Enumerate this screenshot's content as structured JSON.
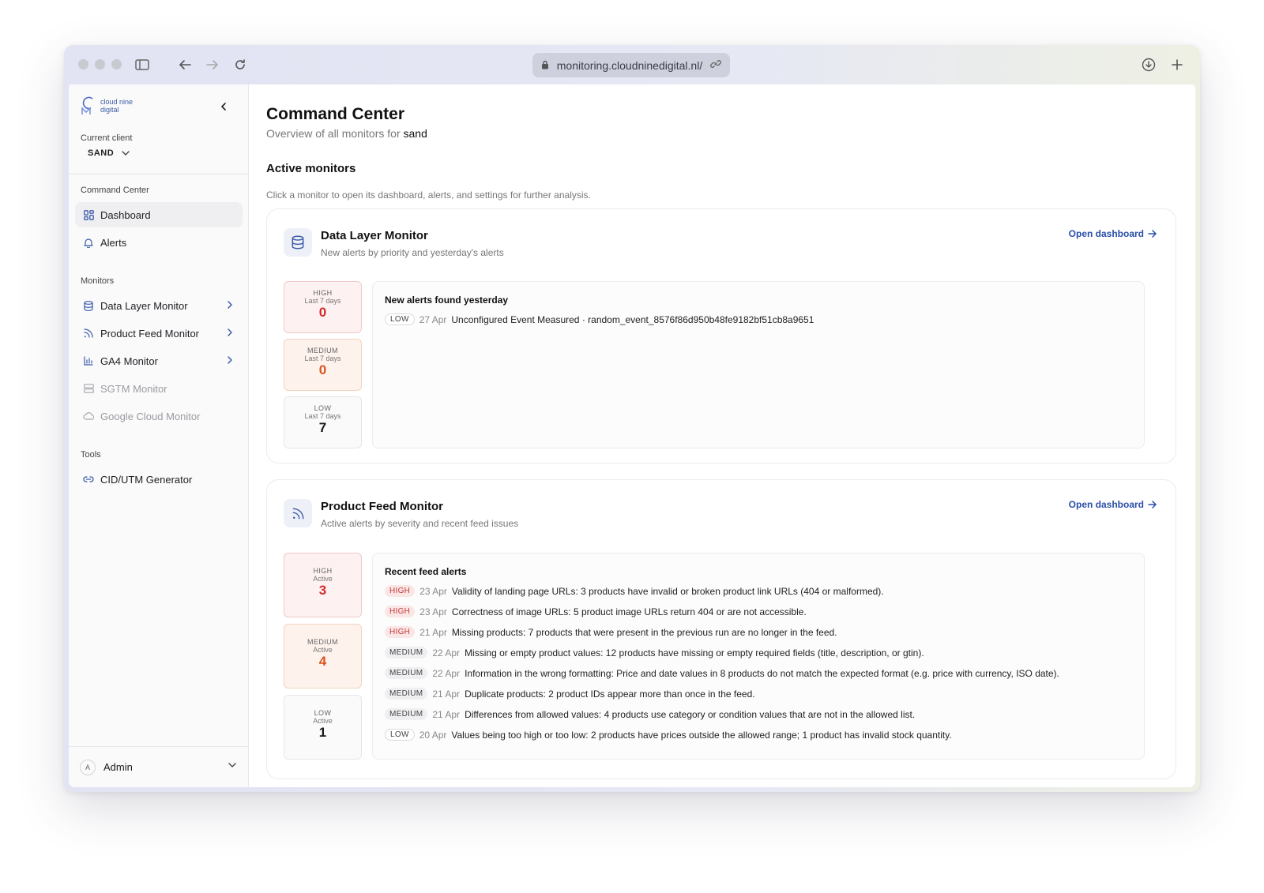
{
  "browser": {
    "url": "monitoring.cloudninedigital.nl/"
  },
  "sidebar": {
    "logo_line1": "cloud nine",
    "logo_line2": "digital",
    "client_label": "Current client",
    "client_value": "SAND",
    "section_command": "Command Center",
    "nav_dashboard": "Dashboard",
    "nav_alerts": "Alerts",
    "section_monitors": "Monitors",
    "monitors": [
      {
        "label": "Data Layer Monitor"
      },
      {
        "label": "Product Feed Monitor"
      },
      {
        "label": "GA4 Monitor"
      },
      {
        "label": "SGTM Monitor"
      },
      {
        "label": "Google Cloud Monitor"
      }
    ],
    "section_tools": "Tools",
    "tool_cid": "CID/UTM Generator",
    "user_initial": "A",
    "user_name": "Admin"
  },
  "page": {
    "title": "Command Center",
    "subtitle_prefix": "Overview of all monitors for",
    "subtitle_client": "sand",
    "section_title": "Active monitors",
    "section_sub": "Click a monitor to open its dashboard, alerts, and settings for further analysis."
  },
  "data_layer": {
    "title": "Data Layer Monitor",
    "subtitle": "New alerts by priority and yesterday's alerts",
    "open_label": "Open dashboard",
    "stats": [
      {
        "level": "HIGH",
        "period": "Last 7 days",
        "value": "0"
      },
      {
        "level": "MEDIUM",
        "period": "Last 7 days",
        "value": "0"
      },
      {
        "level": "LOW",
        "period": "Last 7 days",
        "value": "7"
      }
    ],
    "panel_title": "New alerts found yesterday",
    "alerts": [
      {
        "severity": "LOW",
        "date": "27 Apr",
        "text": "Unconfigured Event Measured · random_event_8576f86d950b48fe9182bf51cb8a9651"
      }
    ]
  },
  "product_feed": {
    "title": "Product Feed Monitor",
    "subtitle": "Active alerts by severity and recent feed issues",
    "open_label": "Open dashboard",
    "stats": [
      {
        "level": "HIGH",
        "period": "Active",
        "value": "3"
      },
      {
        "level": "MEDIUM",
        "period": "Active",
        "value": "4"
      },
      {
        "level": "LOW",
        "period": "Active",
        "value": "1"
      }
    ],
    "panel_title": "Recent feed alerts",
    "alerts": [
      {
        "severity": "HIGH",
        "date": "23 Apr",
        "text": "Validity of landing page URLs: 3 products have invalid or broken product link URLs (404 or malformed)."
      },
      {
        "severity": "HIGH",
        "date": "23 Apr",
        "text": "Correctness of image URLs: 5 product image URLs return 404 or are not accessible."
      },
      {
        "severity": "HIGH",
        "date": "21 Apr",
        "text": "Missing products: 7 products that were present in the previous run are no longer in the feed."
      },
      {
        "severity": "MEDIUM",
        "date": "22 Apr",
        "text": "Missing or empty product values: 12 products have missing or empty required fields (title, description, or gtin)."
      },
      {
        "severity": "MEDIUM",
        "date": "22 Apr",
        "text": "Information in the wrong formatting: Price and date values in 8 products do not match the expected format (e.g. price with currency, ISO date)."
      },
      {
        "severity": "MEDIUM",
        "date": "21 Apr",
        "text": "Duplicate products: 2 product IDs appear more than once in the feed."
      },
      {
        "severity": "MEDIUM",
        "date": "21 Apr",
        "text": "Differences from allowed values: 4 products use category or condition values that are not in the allowed list."
      },
      {
        "severity": "LOW",
        "date": "20 Apr",
        "text": "Values being too high or too low: 2 products have prices outside the allowed range; 1 product has invalid stock quantity."
      }
    ]
  },
  "colors": {
    "accent": "#2a4fa8",
    "high": "#d42a2a",
    "medium": "#d9531e"
  }
}
